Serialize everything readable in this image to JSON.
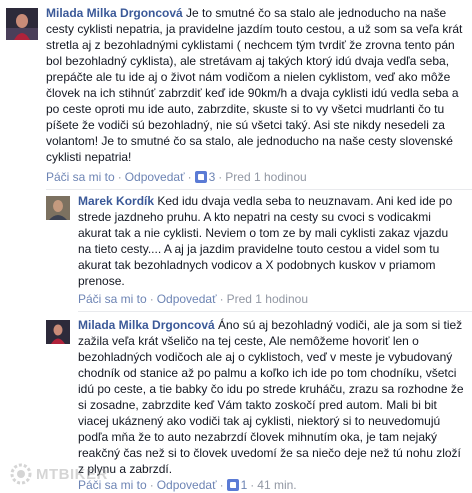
{
  "comments": [
    {
      "author": "Milada Milka Drgoncová",
      "body": "Je to smutné čo sa stalo ale jednoducho na naše cesty cyklisti nepatria, ja pravidelne jazdím touto cestou, a už som sa veľa krát stretla aj z bezohladnými cyklistami ( nechcem tým tvrdiť že zrovna tento pán bol bezohladný cyklista), ale stretávam aj takých ktorý idú dvaja vedľa seba, prepáčte ale tu ide aj o život nám vodičom a nielen cyklistom, veď ako môže človek na ich stihnúť zabrzdiť keď ide 90km/h a dvaja cyklisti idú vedla seba a po ceste oproti mu ide auto, zabrzdite, skuste si to vy všetci mudrlanti čo tu píšete že vodiči sú bezohladný, nie sú všetci taký. Asi ste nikdy nesedeli za volantom! Je to smutné čo sa stalo, ale jednoducho na naše cesty slovenské cyklisti nepatria!",
      "like_label": "Páči sa mi to",
      "reply_label": "Odpovedať",
      "likes": "3",
      "time": "Pred 1 hodinou"
    },
    {
      "author": "Marek Kordík",
      "body": "Ked idu dvaja vedla seba to neuznavam. Ani ked ide po strede jazdneho pruhu. A kto nepatri na cesty su cvoci s vodicakmi akurat tak a nie cyklisti. Neviem o tom ze by mali cyklisti zakaz vjazdu na tieto cesty.... A aj ja jazdim pravidelne touto cestou a videl som tu akurat tak bezohladnych vodicov a X podobnych kuskov v priamom prenose.",
      "like_label": "Páči sa mi to",
      "reply_label": "Odpovedať",
      "time": "Pred 1 hodinou"
    },
    {
      "author": "Milada Milka Drgoncová",
      "body": "Áno sú aj bezohladný vodiči, ale ja som si tiež zažila veľa krát všeličo na tej ceste, Ale nemôžeme hovoriť len o bezohladných vodičoch ale aj o cyklistoch, veď v meste je vybudovaný chodník od stanice až po palmu a koľko ich ide po tom chodníku, všetci idú po ceste, a tie babky čo idu po strede kruháču, zrazu sa rozhodne že si zosadne, zabrzdite keď Vám takto zoskočí pred autom. Mali bi bit viacej ukáznený ako vodiči tak aj cyklisti, niektorý si to neuvedomujú podľa mňa že to auto nezabrzdí človek mihnutím oka, je tam nejaký reakčný čas než si to človek uvedomí že sa niečo deje než tú nohu zloží z plynu a zabrzdí.",
      "like_label": "Páči sa mi to",
      "reply_label": "Odpovedať",
      "likes": "1",
      "time": "41 min."
    }
  ],
  "watermark": {
    "text": "MTBIKER"
  },
  "colors": {
    "link": "#3b5998",
    "meta": "#9197a3",
    "action": "#6d84b4"
  }
}
